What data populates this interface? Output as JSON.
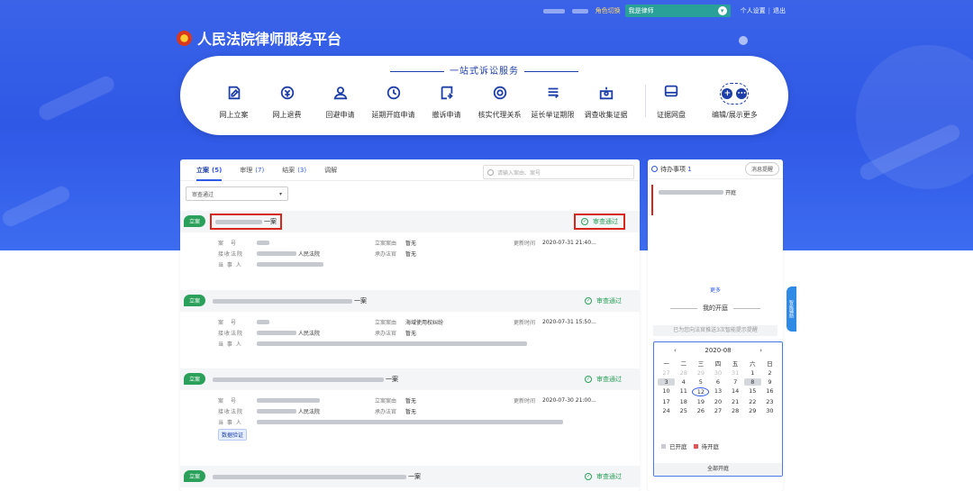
{
  "topbar": {
    "role_label": "角色切换",
    "role_value": "我是律师",
    "settings": "个人设置",
    "separator": "|",
    "logout": "退出"
  },
  "header": {
    "title": "人民法院律师服务平台"
  },
  "services": {
    "title": "一站式诉讼服务",
    "items": [
      {
        "label": "网上立案",
        "icon": "file-edit-icon"
      },
      {
        "label": "网上退费",
        "icon": "refund-icon"
      },
      {
        "label": "回避申请",
        "icon": "person-icon"
      },
      {
        "label": "延期开庭申请",
        "icon": "clock-icon"
      },
      {
        "label": "撤诉申请",
        "icon": "withdraw-icon"
      },
      {
        "label": "核实代理关系",
        "icon": "verify-icon"
      },
      {
        "label": "延长举证期限",
        "icon": "extend-icon"
      },
      {
        "label": "调查收集证据",
        "icon": "evidence-icon"
      }
    ],
    "disk": "证据网盘",
    "more": "编辑/展示更多",
    "more_symbol": "+",
    "more_dots": "•••"
  },
  "tabs": [
    {
      "label": "立案",
      "count": "(5)"
    },
    {
      "label": "审理",
      "count": "(7)"
    },
    {
      "label": "结案",
      "count": "(3)"
    },
    {
      "label": "调解",
      "count": ""
    }
  ],
  "search": {
    "placeholder": "请输入案由、案号"
  },
  "filter": {
    "value": "审查通过"
  },
  "case_labels": {
    "badge": "立案",
    "case_no": "案　号",
    "court": "接收法院",
    "party": "当 事 人",
    "reason": "立案案由",
    "judge": "承办法官",
    "updated": "更新时间",
    "status": "审查通过",
    "verify": "数据验证"
  },
  "cases": [
    {
      "title_suffix": "一案",
      "reason": "暂无",
      "court_suffix": "人民法院",
      "judge": "暂无",
      "updated": "2020-07-31 21:40..."
    },
    {
      "title_suffix": "一案",
      "reason": "海域使用权纠纷",
      "court_suffix": "人民法院",
      "judge": "暂无",
      "updated": "2020-07-31 15:50..."
    },
    {
      "title_suffix": "一案",
      "reason": "暂无",
      "court_suffix": "人民法院",
      "judge": "暂无",
      "updated": "2020-07-30 21:00..."
    },
    {
      "title_suffix": "一案"
    }
  ],
  "sidebar": {
    "todo_title": "待办事项",
    "todo_count": "1",
    "message_btn": "消息提醒",
    "todo_item_suffix": "开庭",
    "more": "更多",
    "my_court": "我的开庭",
    "notice": "已为您向法官推送3次智能提示提醒",
    "month": "2020-08",
    "weekdays": [
      "一",
      "二",
      "三",
      "四",
      "五",
      "六",
      "日"
    ],
    "legend_held": "已开庭",
    "legend_pending": "待开庭",
    "all_courts": "全部开庭",
    "side_tab": "智能辅助"
  },
  "colors": {
    "brand": "#2f58e6",
    "status_ok": "#2aa05a",
    "highlight_red": "#d9261c"
  }
}
